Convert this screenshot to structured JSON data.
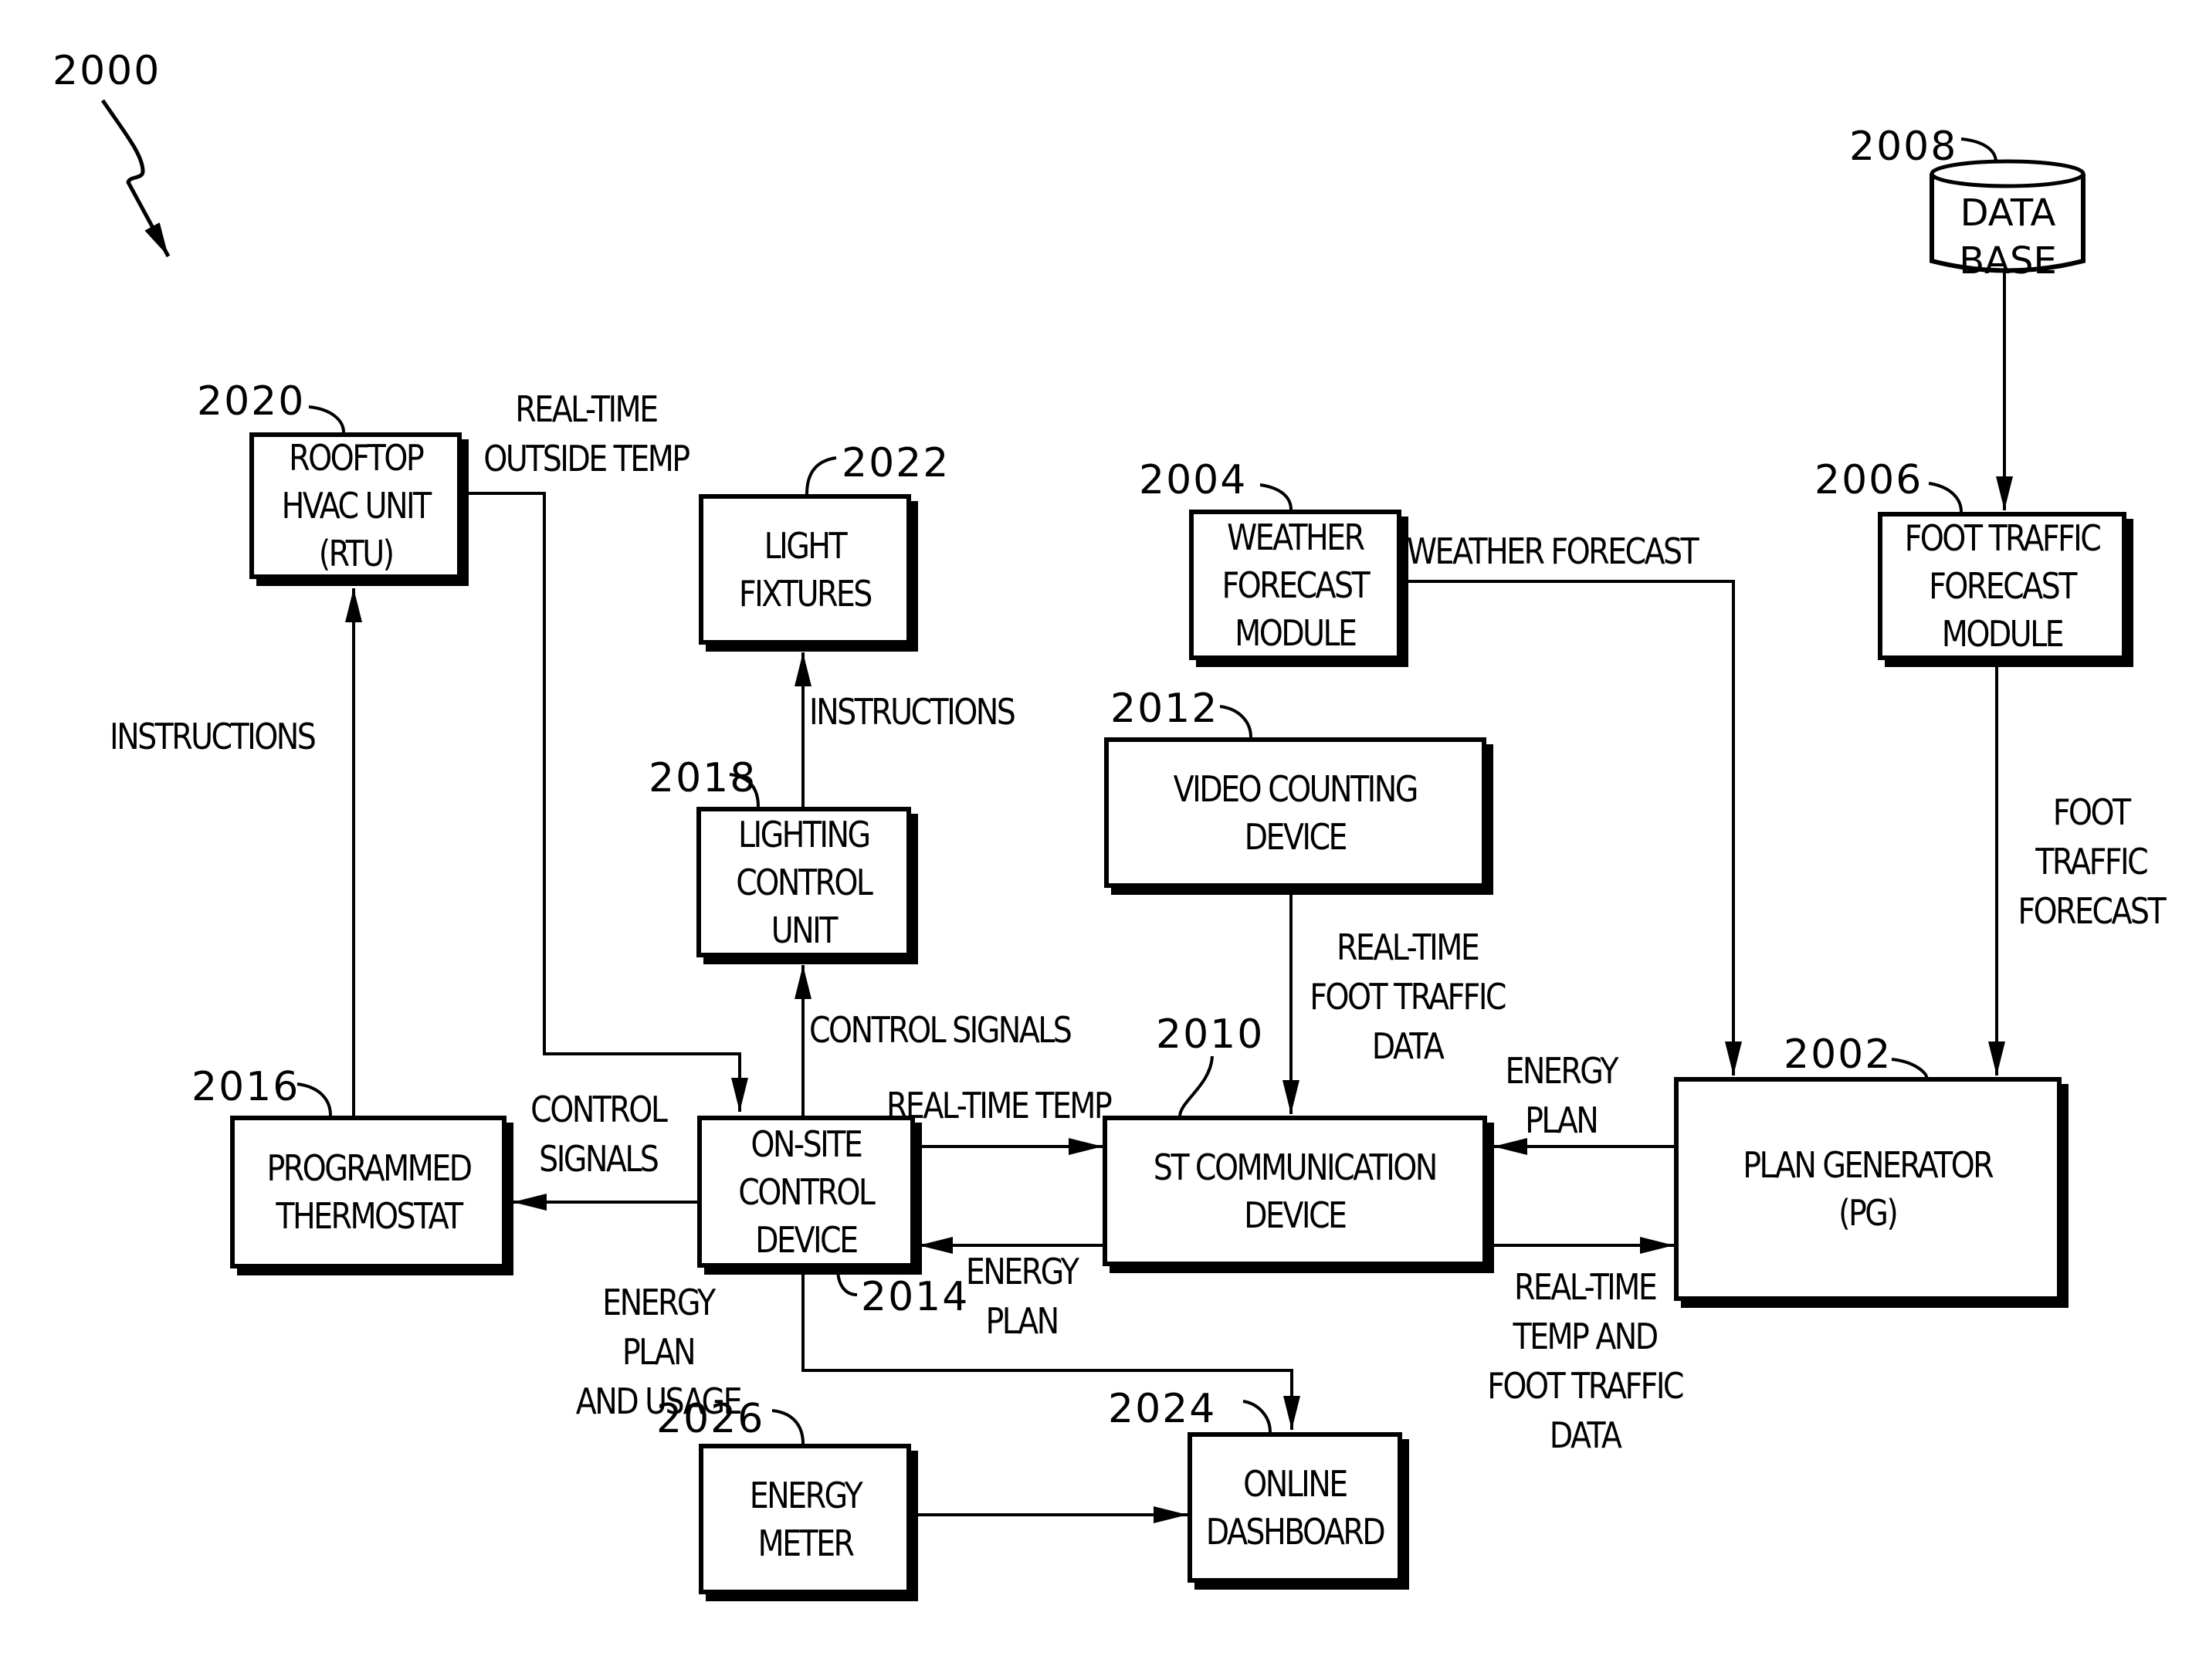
{
  "figure": {
    "ref": "2000"
  },
  "nodes": {
    "rtu": {
      "ref": "2020",
      "label": "ROOFTOP\nHVAC UNIT\n(RTU)"
    },
    "light_fixtures": {
      "ref": "2022",
      "label": "LIGHT\nFIXTURES"
    },
    "weather_module": {
      "ref": "2004",
      "label": "WEATHER\nFORECAST\nMODULE"
    },
    "foot_traffic_module": {
      "ref": "2006",
      "label": "FOOT TRAFFIC\nFORECAST\nMODULE"
    },
    "database": {
      "ref": "2008",
      "label": "DATA\nBASE"
    },
    "video_counting": {
      "ref": "2012",
      "label": "VIDEO COUNTING\nDEVICE"
    },
    "lighting_control": {
      "ref": "2018",
      "label": "LIGHTING\nCONTROL\nUNIT"
    },
    "thermostat": {
      "ref": "2016",
      "label": "PROGRAMMED\nTHERMOSTAT"
    },
    "onsite_control": {
      "ref": "2014",
      "label": "ON-SITE\nCONTROL\nDEVICE"
    },
    "st_comm": {
      "ref": "2010",
      "label": "ST COMMUNICATION\nDEVICE"
    },
    "plan_generator": {
      "ref": "2002",
      "label": "PLAN GENERATOR\n(PG)"
    },
    "energy_meter": {
      "ref": "2026",
      "label": "ENERGY\nMETER"
    },
    "online_dashboard": {
      "ref": "2024",
      "label": "ONLINE\nDASHBOARD"
    }
  },
  "flows": {
    "rtu_outside_temp": "REAL-TIME\nOUTSIDE TEMP",
    "thermostat_to_rtu": "INSTRUCTIONS",
    "lcu_to_fixtures": "INSTRUCTIONS",
    "onsite_to_lcu": "CONTROL SIGNALS",
    "onsite_to_thermostat": "CONTROL\nSIGNALS",
    "onsite_to_st": "REAL-TIME TEMP",
    "st_to_onsite": "ENERGY\nPLAN",
    "onsite_to_dashboard": "ENERGY PLAN\nAND USAGE",
    "video_to_st": "REAL-TIME\nFOOT TRAFFIC\nDATA",
    "weather_to_pg": "WEATHER FORECAST",
    "foot_traffic_to_pg": "FOOT\nTRAFFIC\nFORECAST",
    "pg_to_st": "ENERGY\nPLAN",
    "st_to_pg": "REAL-TIME\nTEMP AND\nFOOT TRAFFIC\nDATA"
  }
}
